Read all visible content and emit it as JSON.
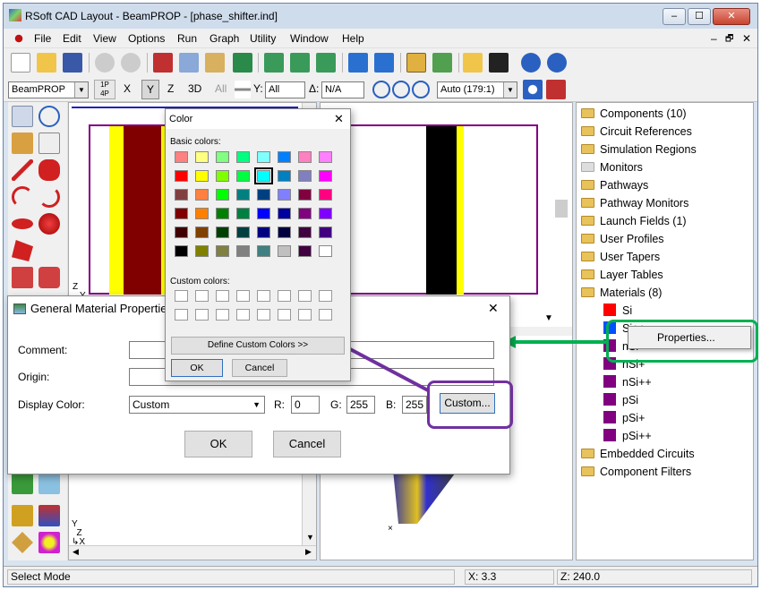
{
  "window": {
    "title": "RSoft CAD Layout - BeamPROP - [phase_shifter.ind]",
    "minimize": "‒",
    "maximize": "☐",
    "close": "✕",
    "mdi_min": "‒",
    "mdi_restore": "🗗",
    "mdi_close": "✕"
  },
  "menu": [
    "File",
    "Edit",
    "View",
    "Options",
    "Run",
    "Graph",
    "Utility",
    "Window",
    "Help"
  ],
  "toolbar2": {
    "program": "BeamPROP",
    "p1": "1P",
    "p4": "4P",
    "x": "X",
    "y": "Y",
    "z": "Z",
    "three_d": "3D",
    "all": "All",
    "y_label": "Y:",
    "y_value": "All",
    "delta_label": "Δ:",
    "delta_value": "N/A",
    "zoom": "Auto (179:1)"
  },
  "tree": {
    "items": [
      "Components (10)",
      "Circuit References",
      "Simulation Regions",
      "Monitors",
      "Pathways",
      "Pathway Monitors",
      "Launch Fields (1)",
      "User Profiles",
      "User Tapers",
      "Layer Tables",
      "Materials (8)"
    ],
    "materials": [
      {
        "name": "Si",
        "color": "#ff0000"
      },
      {
        "name": "Si++",
        "color": "#0050ff"
      },
      {
        "name": "nSi",
        "color": "#800080"
      },
      {
        "name": "nSi+",
        "color": "#800080"
      },
      {
        "name": "nSi++",
        "color": "#800080"
      },
      {
        "name": "pSi",
        "color": "#800080"
      },
      {
        "name": "pSi+",
        "color": "#800080"
      },
      {
        "name": "pSi++",
        "color": "#800080"
      }
    ],
    "tail": [
      "Embedded Circuits",
      "Component Filters"
    ]
  },
  "context_menu": {
    "properties": "Properties..."
  },
  "status": {
    "mode": "Select Mode",
    "x": "X: 3.3",
    "z": "Z: 240.0"
  },
  "color_dialog": {
    "title": "Color",
    "basic": "Basic colors:",
    "custom": "Custom colors:",
    "define": "Define Custom Colors >>",
    "ok": "OK",
    "cancel": "Cancel",
    "colors": [
      "#ff8080",
      "#ffff80",
      "#80ff80",
      "#00ff80",
      "#80ffff",
      "#0080ff",
      "#ff80c0",
      "#ff80ff",
      "#ff0000",
      "#ffff00",
      "#80ff00",
      "#00ff40",
      "#00ffff",
      "#0080c0",
      "#8080c0",
      "#ff00ff",
      "#804040",
      "#ff8040",
      "#00ff00",
      "#008080",
      "#004080",
      "#8080ff",
      "#800040",
      "#ff0080",
      "#800000",
      "#ff8000",
      "#008000",
      "#008040",
      "#0000ff",
      "#0000a0",
      "#800080",
      "#8000ff",
      "#400000",
      "#804000",
      "#004000",
      "#004040",
      "#000080",
      "#000040",
      "#400040",
      "#400080",
      "#000000",
      "#808000",
      "#808040",
      "#808080",
      "#408080",
      "#c0c0c0",
      "#400040",
      "#ffffff"
    ]
  },
  "material_dialog": {
    "title": "General Material Properties",
    "comment": "Comment:",
    "origin": "Origin:",
    "display_color": "Display Color:",
    "color_value": "Custom",
    "r": "R:",
    "r_val": "0",
    "g": "G:",
    "g_val": "255",
    "b": "B:",
    "b_val": "255",
    "custom": "Custom...",
    "ok": "OK",
    "cancel": "Cancel"
  },
  "accents": {
    "purple": "#7030a0",
    "green": "#00b050"
  }
}
